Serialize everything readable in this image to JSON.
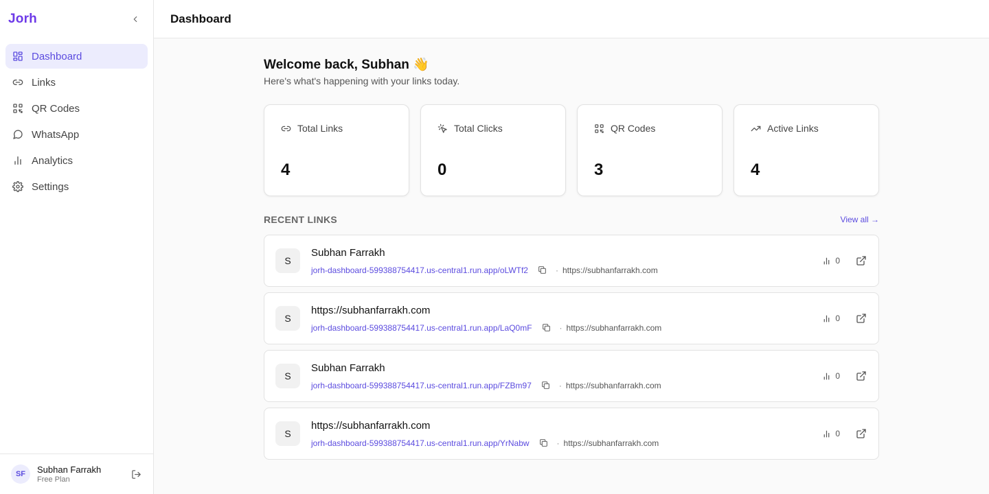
{
  "app": {
    "brand": "Jorh",
    "accent": "#5b4bdf"
  },
  "sidebar": {
    "collapse_icon": "chevron-left-icon",
    "items": [
      {
        "label": "Dashboard",
        "icon": "grid-icon",
        "active": true
      },
      {
        "label": "Links",
        "icon": "link-icon"
      },
      {
        "label": "QR Codes",
        "icon": "qr-code-icon"
      },
      {
        "label": "WhatsApp",
        "icon": "chat-bubble-icon"
      },
      {
        "label": "Analytics",
        "icon": "bar-chart-icon"
      },
      {
        "label": "Settings",
        "icon": "gear-icon"
      }
    ],
    "user": {
      "initials": "SF",
      "name": "Subhan Farrakh",
      "plan": "Free Plan"
    }
  },
  "header": {
    "title": "Dashboard"
  },
  "main": {
    "welcome": "Welcome back, Subhan 👋",
    "subtitle": "Here's what's happening with your links today.",
    "stats": [
      {
        "label": "Total Links",
        "value": "4",
        "icon": "link-icon"
      },
      {
        "label": "Total Clicks",
        "value": "0",
        "icon": "pointer-click-icon"
      },
      {
        "label": "QR Codes",
        "value": "3",
        "icon": "qr-code-icon"
      },
      {
        "label": "Active Links",
        "value": "4",
        "icon": "trending-up-icon"
      }
    ],
    "recent": {
      "title": "RECENT LINKS",
      "view_all": "View all →",
      "links": [
        {
          "letter": "S",
          "title": "Subhan Farrakh",
          "short_url": "jorh-dashboard-599388754417.us-central1.run.app/oLWTf2",
          "dot": "·",
          "dest": "https://subhanfarrakh.com",
          "clicks": "0"
        },
        {
          "letter": "S",
          "title": "https://subhanfarrakh.com",
          "short_url": "jorh-dashboard-599388754417.us-central1.run.app/LaQ0mF",
          "dot": "·",
          "dest": "https://subhanfarrakh.com",
          "clicks": "0"
        },
        {
          "letter": "S",
          "title": "Subhan Farrakh",
          "short_url": "jorh-dashboard-599388754417.us-central1.run.app/FZBm97",
          "dot": "·",
          "dest": "https://subhanfarrakh.com",
          "clicks": "0"
        },
        {
          "letter": "S",
          "title": "https://subhanfarrakh.com",
          "short_url": "jorh-dashboard-599388754417.us-central1.run.app/YrNabw",
          "dot": "·",
          "dest": "https://subhanfarrakh.com",
          "clicks": "0"
        }
      ]
    }
  }
}
